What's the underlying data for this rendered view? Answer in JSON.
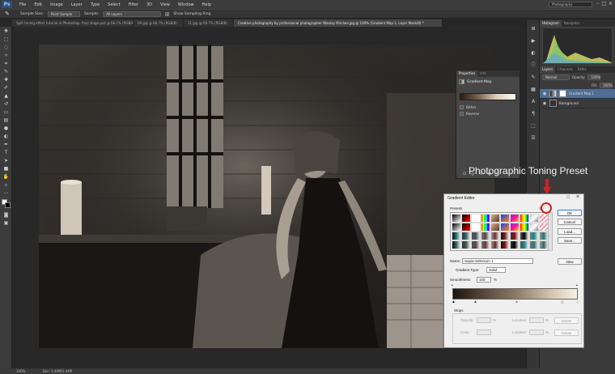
{
  "app": {
    "logo": "Ps",
    "workspace": "Photography"
  },
  "menu": [
    "File",
    "Edit",
    "Image",
    "Layer",
    "Type",
    "Select",
    "Filter",
    "3D",
    "View",
    "Window",
    "Help"
  ],
  "options_bar": {
    "sample_size_label": "Sample Size:",
    "sample_size_value": "Point Sample",
    "sample_label": "Sample:",
    "sample_value": "All Layers",
    "show_ring_label": "Show Sampling Ring"
  },
  "tabs": [
    "Split toning effect tutorial in Photoshop. final stage.psd @ 66.7% (RGB/8)",
    "09.jpg @ 66.7% (RGB/8)",
    "11.jpg @ 66.7% (RGB/8)",
    "Creative photography by professional photographer Nikolay Mirchev.jpg @ 100% (Gradient Map 1, Layer Mask/8) *"
  ],
  "status": {
    "zoom": "100%",
    "doc": "Doc: 1.44M/1.44M"
  },
  "right_panel": {
    "top_tabs": [
      "Histogram",
      "Navigator"
    ],
    "layer_tabs": [
      "Layers",
      "Channels",
      "Paths"
    ],
    "blend_mode": "Normal",
    "opacity_label": "Opacity:",
    "opacity_value": "100%",
    "fill_label": "Fill:",
    "fill_value": "100%",
    "layers": [
      {
        "name": "Gradient Map 1",
        "selected": true
      },
      {
        "name": "Background",
        "selected": false
      }
    ]
  },
  "properties": {
    "tabs": [
      "Properties",
      "Info"
    ],
    "title": "Gradient Map",
    "dither": "Dither",
    "reverse": "Reverse"
  },
  "callout": "Photographic Toning Preset",
  "gradient_editor": {
    "title": "Gradient Editor",
    "presets_label": "Presets",
    "buttons": {
      "ok": "OK",
      "cancel": "Cancel",
      "load": "Load...",
      "save": "Save...",
      "new": "New"
    },
    "name_label": "Name:",
    "name_value": "Sepia-Selenium 1",
    "type_label": "Gradient Type:",
    "type_value": "Solid",
    "smooth_label": "Smoothness:",
    "smooth_value": "100",
    "smooth_unit": "%",
    "stops_label": "Stops",
    "opacity_label": "Opacity:",
    "color_label": "Color:",
    "location_label": "Location:",
    "pct": "%",
    "delete_label": "Delete"
  },
  "colors": {
    "selected_layer": "#4f6e94",
    "highlight": "#d42020"
  }
}
